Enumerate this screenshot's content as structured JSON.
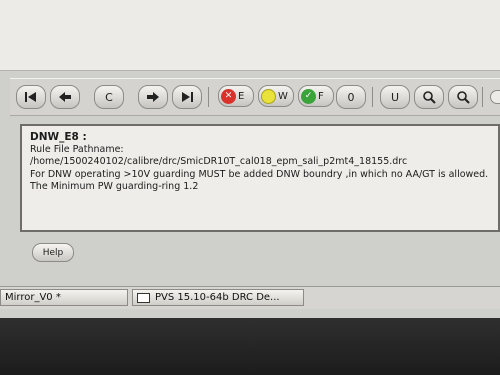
{
  "toolbar": {
    "first_icon": "skip-first-icon",
    "prev_icon": "arrow-left-icon",
    "current_label": "C",
    "next_icon": "arrow-right-icon",
    "last_icon": "skip-last-icon",
    "error_label": "E",
    "warning_label": "W",
    "fixed_label": "F",
    "other_label": "0",
    "undo_label": "U",
    "zoom_in_icon": "zoom-in-icon",
    "zoom_out_icon": "zoom-out-icon",
    "colors": {
      "error": "#d8322b",
      "warning": "#e8e23a",
      "fixed": "#3aa33a"
    }
  },
  "details": {
    "title": "DNW_E8 :",
    "line1": "Rule File Pathname: /home/1500240102/calibre/drc/SmicDR10T_cal018_epm_sali_p2mt4_18155.drc",
    "line2": "For DNW operating >10V guarding MUST be added DNW boundry ,in which no AA/GT is allowed.",
    "line3": "The Minimum PW guarding-ring 1.2"
  },
  "help": {
    "label": "Help"
  },
  "taskbar": {
    "task1": "Mirror_V0 *",
    "task2": "PVS 15.10-64b DRC De..."
  }
}
